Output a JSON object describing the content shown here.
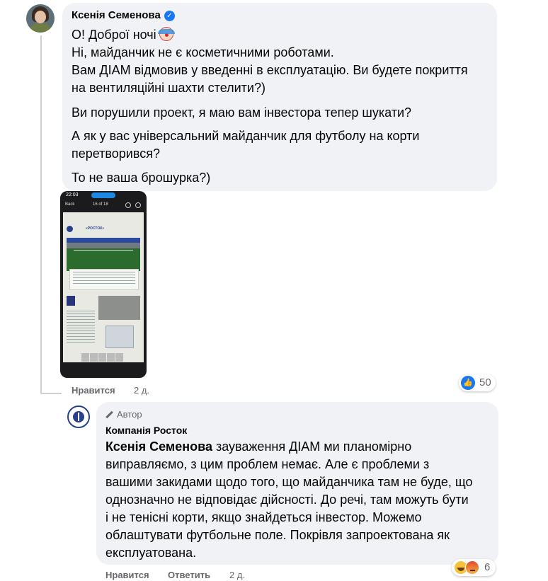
{
  "comment1": {
    "author": "Ксенія Семенова",
    "lines": [
      "О! Доброї ночі",
      "Ні, майданчик не є косметичними роботами.",
      "Вам ДІАМ відмовив у введенні в експлуатацію. Ви будете покриття",
      "на вентиляційні шахти стелити?)",
      "Ви порушили проект, я маю вам інвестора тепер шукати?",
      "А як у вас універсальний майданчик для футболу на корти",
      "перетворився?",
      "То не ваша брошурка?)"
    ],
    "photo": {
      "status_time": "22:03",
      "topbar_back": "Back",
      "topbar_page": "16 of 18",
      "brand": "«РОСТОК»"
    },
    "actions": {
      "like": "Нравится",
      "time": "2 д."
    },
    "reactions": {
      "icon": "like-icon",
      "count": "50"
    }
  },
  "comment2": {
    "badge": "Автор",
    "author": "Компанія Росток",
    "mention": "Ксенія Семенова",
    "lines": [
      " зауваження ДІАМ ми планомірно",
      "виправляємо, з цим проблем немає. Але є проблеми з",
      "вашими закидами щодо того, що майданчика там не буде, що",
      "однозначно не відповідає дійсності. До речі, там можуть бути",
      "і не тенісні корти, якщо знайдеться інвестор. Можемо",
      "облаштувати футбольне поле. Покрівля запроектована як",
      "експлуатована."
    ],
    "actions": {
      "like": "Нравится",
      "reply": "Ответить",
      "time": "2 д."
    },
    "reactions": {
      "icons": [
        "haha-icon",
        "angry-icon"
      ],
      "count": "6"
    }
  },
  "colors": {
    "bubble": "#f0f2f5",
    "accent": "#1877f2",
    "muted": "#65676b"
  }
}
